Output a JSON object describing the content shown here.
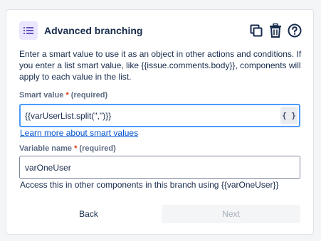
{
  "panel": {
    "title": "Advanced branching",
    "icon": "list-icon",
    "accent_color": "#6554c0",
    "actions": [
      "copy-icon",
      "trash-icon",
      "help-icon"
    ]
  },
  "description": "Enter a smart value to use it as an object in other actions and conditions. If you enter a list smart value, like {{issue.comments.body}}, components will apply to each value in the list.",
  "smart_value": {
    "label": "Smart value",
    "required_mark": "*",
    "required_text": "(required)",
    "value": "{{varUserList.split(\",\")}}",
    "insert_button": "{ }",
    "learn_more": "Learn more about smart values"
  },
  "variable_name": {
    "label": "Variable name",
    "required_mark": "*",
    "required_text": "(required)",
    "value": "varOneUser",
    "helper": "Access this in other components in this branch using {{varOneUser}}"
  },
  "footer": {
    "back_label": "Back",
    "next_label": "Next",
    "next_disabled": true
  }
}
